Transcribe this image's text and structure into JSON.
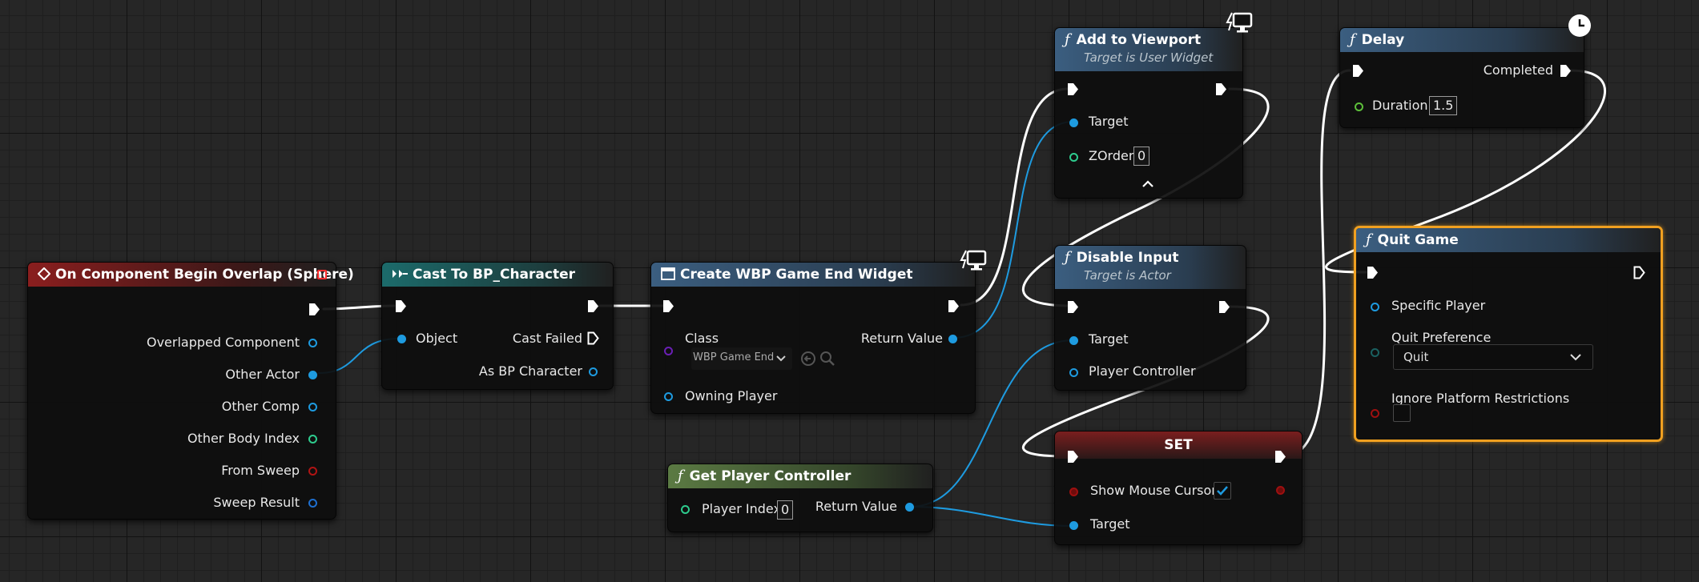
{
  "nodes": {
    "overlap": {
      "title": "On Component Begin Overlap (Sphere)",
      "pins": [
        "Overlapped Component",
        "Other Actor",
        "Other Comp",
        "Other Body Index",
        "From Sweep",
        "Sweep Result"
      ]
    },
    "cast": {
      "title": "Cast To BP_Character",
      "object": "Object",
      "cast_failed": "Cast Failed",
      "as_bp": "As BP Character"
    },
    "create": {
      "title": "Create WBP Game End Widget",
      "class_label": "Class",
      "class_value": "WBP Game End",
      "return_value": "Return Value",
      "owning_player": "Owning Player"
    },
    "getpc": {
      "title": "Get Player Controller",
      "player_index": "Player Index",
      "index_value": "0",
      "return_value": "Return Value"
    },
    "viewport": {
      "title": "Add to Viewport",
      "subtitle": "Target is User Widget",
      "target": "Target",
      "zorder": "ZOrder",
      "zorder_value": "0"
    },
    "disable": {
      "title": "Disable Input",
      "subtitle": "Target is Actor",
      "target": "Target",
      "pc": "Player Controller"
    },
    "set": {
      "title": "SET",
      "show_cursor": "Show Mouse Cursor",
      "target": "Target",
      "checked": true
    },
    "delay": {
      "title": "Delay",
      "completed": "Completed",
      "duration": "Duration",
      "duration_value": "1.5"
    },
    "quit": {
      "title": "Quit Game",
      "specific_player": "Specific Player",
      "quit_pref": "Quit Preference",
      "quit_pref_value": "Quit",
      "ignore": "Ignore Platform Restrictions"
    }
  },
  "colors": {
    "object_pin": "#1e9be0",
    "int_pin": "#2ecc8e",
    "bool_pin": "#9e1010",
    "class_pin": "#6a1fb5",
    "struct_pin": "#1e6fd0",
    "exec_pin": "#ffffff",
    "selection": "#f0a020"
  },
  "icons": {
    "event": "event-diamond-icon",
    "cast": "cast-arrows-icon",
    "widget": "widget-icon",
    "function": "function-icon",
    "delay": "clock-icon",
    "screen": "monitor-icon"
  }
}
